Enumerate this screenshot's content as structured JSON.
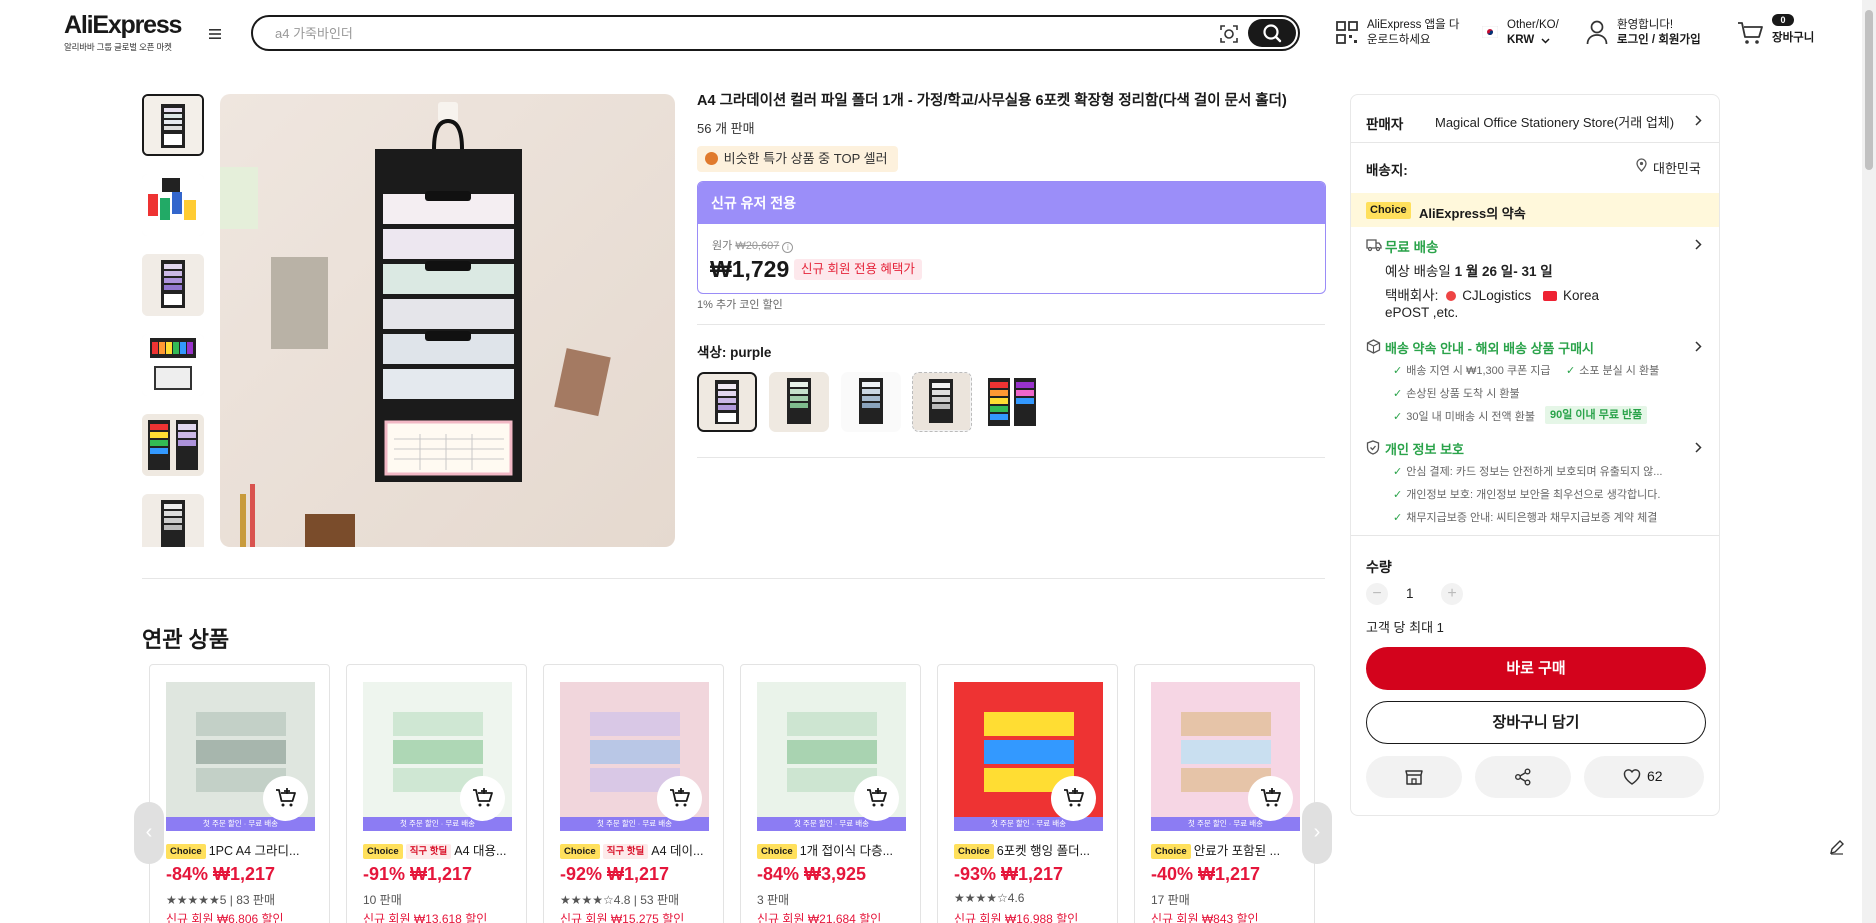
{
  "header": {
    "logo": "AliExpress",
    "logo_sub": "알리바바 그룹 글로벌 오픈 마켓",
    "search_placeholder": "a4 가죽바인더",
    "app_line1": "AliExpress 앱을 다",
    "app_line2": "운로드하세요",
    "region_line1": "Other/KO/",
    "region_line2": "KRW",
    "welcome_line1": "환영합니다!",
    "welcome_line2": "로그인 / 회원가입",
    "cart_count": "0",
    "cart_label": "장바구니"
  },
  "product": {
    "title": "A4 그라데이션 컬러 파일 폴더 1개 - 가정/학교/사무실용 6포켓 확장형 정리함(다색 걸이 문서 홀더)",
    "sold": "56 개 판매",
    "top_seller": "비슷한 특가 상품 중 TOP 셀러",
    "promo_header": "신규 유저 전용",
    "original_label": "원가",
    "original_price": "₩20,607",
    "price": "₩1,729",
    "new_badge": "신규 회원 전용 혜택가",
    "coin": "1% 추가 코인 할인",
    "color_label": "색상: ",
    "color_value": "purple"
  },
  "related": {
    "title": "연관 상품",
    "prev": "‹",
    "next": "›",
    "items": [
      {
        "chips": [
          "Choice"
        ],
        "title": "1PC A4 그라디...",
        "price": "-84% ₩1,217",
        "rating": "★★★★★5 | 83 판매",
        "newline": "신규 회원 ₩6,806 할인",
        "strip": "첫 주문 할인 · 무료 배송"
      },
      {
        "chips": [
          "Choice",
          "직구 핫딜"
        ],
        "title": "A4 대용...",
        "price": "-91% ₩1,217",
        "rating": "10 판매",
        "newline": "신규 회원 ₩13,618 할인",
        "strip": "첫 주문 할인 · 무료 배송"
      },
      {
        "chips": [
          "Choice",
          "직구 핫딜"
        ],
        "title": "A4 데이...",
        "price": "-92% ₩1,217",
        "rating": "★★★★☆4.8 | 53 판매",
        "newline": "신규 회원 ₩15,275 할인",
        "strip": "첫 주문 할인 · 무료 배송"
      },
      {
        "chips": [
          "Choice"
        ],
        "title": "1개 접이식 다층...",
        "price": "-84% ₩3,925",
        "rating": "3 판매",
        "newline": "신규 회원 ₩21,684 할인",
        "strip": "첫 주문 할인 · 무료 배송"
      },
      {
        "chips": [
          "Choice"
        ],
        "title": "6포켓 행잉 폴더...",
        "price": "-93% ₩1,217",
        "rating": "★★★★☆4.6",
        "newline": "신규 회원 ₩16,988 할인",
        "strip": "첫 주문 할인 · 무료 배송"
      },
      {
        "chips": [
          "Choice"
        ],
        "title": "안료가 포함된 ...",
        "price": "-40% ₩1,217",
        "rating": "17 판매",
        "newline": "신규 회원 ₩843 할인",
        "strip": "첫 주문 할인 · 무료 배송"
      }
    ]
  },
  "panel": {
    "seller_label": "판매자",
    "seller_name": "Magical Office Stationery Store(거래 업체)",
    "ship_to_label": "배송지:",
    "ship_to_value": "대한민국",
    "choice_chip": "Choice",
    "choice_title": "AliExpress의 약속",
    "free_shipping": "무료 배송",
    "eta_prefix": "예상 배송일 ",
    "eta_value": "1 월 26 일- 31 일",
    "carrier_prefix": "택배회사: ",
    "carrier_1": "CJLogistics",
    "carrier_2": "Korea",
    "carrier_3": "ePOST ,etc.",
    "promise_title": "배송 약속 안내 - 해외 배송 상품 구매시",
    "promise_items": [
      "배송 지연 시 ₩1,300 쿠폰 지급",
      "소포 분실 시 환불",
      "손상된 상품 도착 시 환불",
      "30일 내 미배송 시 전액 환불"
    ],
    "refund_badge": "90일 이내 무료 반품",
    "privacy_title": "개인 정보 보호",
    "privacy_items": [
      "안심 결제: 카드 정보는 안전하게 보호되며 유출되지 않...",
      "개인정보 보호: 개인정보 보안을 최우선으로 생각합니다.",
      "채무지급보증 안내: 씨티은행과 채무지급보증 계약 체결"
    ],
    "qty_label": "수량",
    "qty_value": "1",
    "qty_limit": "고객 당 최대 1",
    "buy_now": "바로 구매",
    "add_cart": "장바구니 담기",
    "wish_count": "62"
  },
  "colors": {
    "accent_red": "#d3031c",
    "promo_purple": "#9b8ef9",
    "choice_yellow": "#ffe05c",
    "price_red": "#e5163b",
    "green": "#2aa34a"
  }
}
